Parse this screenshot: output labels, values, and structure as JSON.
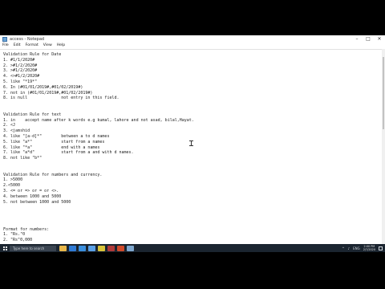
{
  "window": {
    "title": "access - Notepad",
    "min_glyph": "–",
    "max_glyph": "□",
    "close_glyph": "✕"
  },
  "menu": [
    "File",
    "Edit",
    "Format",
    "View",
    "Help"
  ],
  "document": {
    "lines": [
      "Validation Rule for Date",
      "1. #1/1/2020#",
      "2. >#1/2/2020#",
      "3. >#1/2/2020#",
      "4. <>#1/2/2020#",
      "5. like \"*19*\"",
      "6. In (#01/01/2019#,#01/02/2019#)",
      "7. not in (#01/01/2019#,#01/02/2019#)",
      "8. is null              not entry in this field.",
      "",
      "",
      "Validation Rule for text",
      "1. in    accept name after k words e.g kumal, lahore and not asad, bilal,Hayat.",
      "2. <J",
      "3. <jamshid",
      "4. like \"[a-d]*\"        between a to d names",
      "5. like \"a*\"            start from a names",
      "6. like \"*a\"            end with a names",
      "7. like \"a*d\"           start from a and with d names.",
      "8. not like \"b*\"",
      "",
      "",
      "Validation Rule for numbers and currency.",
      "1. >5000",
      "2.<5000",
      "3. <= or => or = or <>.",
      "4. between 1000 and 5000",
      "5. not between 1000 and 5000",
      "",
      "",
      "",
      "",
      "Format for numbers:",
      "1. \"Rs.\"0",
      "2. \"Rs\"0,000"
    ]
  },
  "taskbar": {
    "search_placeholder": "Type here to search",
    "apps": [
      {
        "name": "file-explorer-icon",
        "color": "#e8b74a"
      },
      {
        "name": "edge-icon",
        "color": "#2f7bd6"
      },
      {
        "name": "store-icon",
        "color": "#3a8fde"
      },
      {
        "name": "mail-icon",
        "color": "#5aa0e6"
      },
      {
        "name": "chrome-icon",
        "color": "#d9c43a"
      },
      {
        "name": "access-icon",
        "color": "#b03a3a"
      },
      {
        "name": "powerpoint-icon",
        "color": "#d04a2a"
      },
      {
        "name": "notepad-icon",
        "color": "#7fa8cf"
      }
    ],
    "tray_glyphs": [
      "^",
      "♪",
      "ENG"
    ],
    "time": "2:00 PM",
    "date": "2/7/2020"
  }
}
